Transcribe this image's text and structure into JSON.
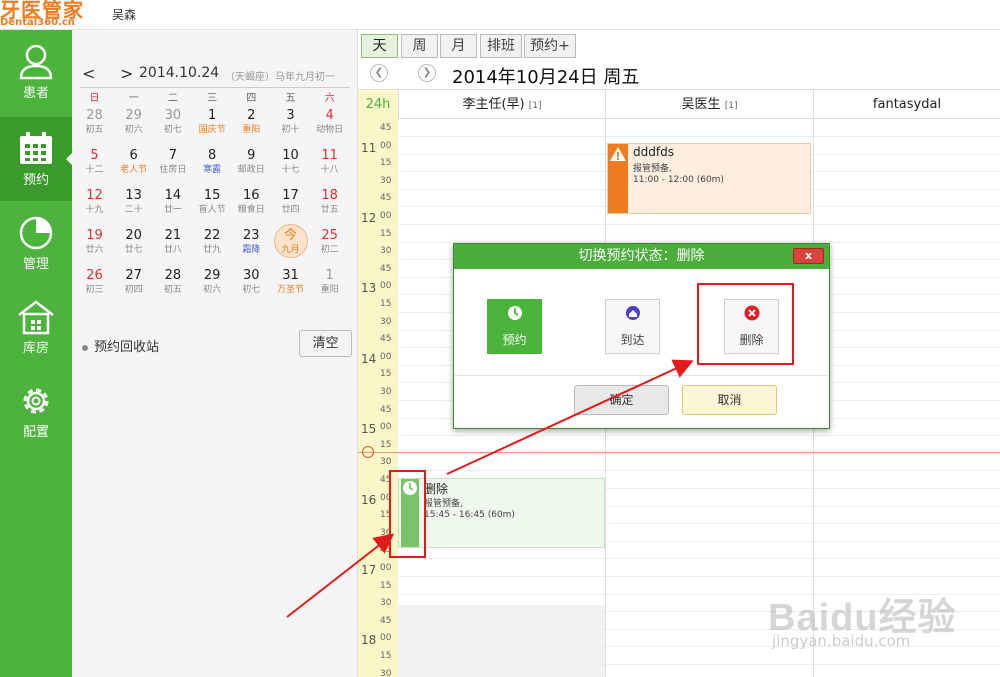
{
  "app": {
    "logo": "牙医管家",
    "logo_sub": "Dental360.cn",
    "user": "吴森"
  },
  "nav": [
    {
      "label": "患者",
      "icon": "person-icon"
    },
    {
      "label": "预约",
      "icon": "calendar-icon"
    },
    {
      "label": "管理",
      "icon": "pie-chart-icon"
    },
    {
      "label": "库房",
      "icon": "warehouse-icon"
    },
    {
      "label": "配置",
      "icon": "gear-icon"
    }
  ],
  "mini_calendar": {
    "prev": "<",
    "next": ">",
    "date": "2014.10.24",
    "lunar": "（天蝎座）马年九月初一",
    "weekdays": [
      "日",
      "一",
      "二",
      "三",
      "四",
      "五",
      "六"
    ],
    "weeks": [
      [
        {
          "n": "28",
          "l": "初五",
          "g": 1
        },
        {
          "n": "29",
          "l": "初六",
          "g": 1
        },
        {
          "n": "30",
          "l": "初七",
          "g": 1
        },
        {
          "n": "1",
          "l": "国庆节",
          "c": "orange"
        },
        {
          "n": "2",
          "l": "重阳",
          "c": "orange"
        },
        {
          "n": "3",
          "l": "初十"
        },
        {
          "n": "4",
          "l": "动物日",
          "r": 1
        }
      ],
      [
        {
          "n": "5",
          "l": "十二",
          "r": 1
        },
        {
          "n": "6",
          "l": "老人节",
          "c": "orange"
        },
        {
          "n": "7",
          "l": "住房日"
        },
        {
          "n": "8",
          "l": "寒露",
          "c": "blue"
        },
        {
          "n": "9",
          "l": "邮政日"
        },
        {
          "n": "10",
          "l": "十七"
        },
        {
          "n": "11",
          "l": "十八",
          "r": 1
        }
      ],
      [
        {
          "n": "12",
          "l": "十九",
          "r": 1
        },
        {
          "n": "13",
          "l": "二十"
        },
        {
          "n": "14",
          "l": "廿一"
        },
        {
          "n": "15",
          "l": "盲人节"
        },
        {
          "n": "16",
          "l": "粮食日"
        },
        {
          "n": "17",
          "l": "廿四"
        },
        {
          "n": "18",
          "l": "廿五",
          "r": 1
        }
      ],
      [
        {
          "n": "19",
          "l": "廿六",
          "r": 1
        },
        {
          "n": "20",
          "l": "廿七"
        },
        {
          "n": "21",
          "l": "廿八"
        },
        {
          "n": "22",
          "l": "廿九"
        },
        {
          "n": "23",
          "l": "霜降",
          "c": "blue"
        },
        {
          "n": "今",
          "l": "九月",
          "t": 1
        },
        {
          "n": "25",
          "l": "初二",
          "r": 1
        }
      ],
      [
        {
          "n": "26",
          "l": "初三",
          "r": 1
        },
        {
          "n": "27",
          "l": "初四"
        },
        {
          "n": "28",
          "l": "初五"
        },
        {
          "n": "29",
          "l": "初六"
        },
        {
          "n": "30",
          "l": "初七"
        },
        {
          "n": "31",
          "l": "万圣节",
          "c": "orange"
        },
        {
          "n": "1",
          "l": "重阳",
          "g": 1
        }
      ]
    ],
    "recycle_label": "预约回收站",
    "clear_label": "清空"
  },
  "schedule": {
    "view_tabs": [
      "天",
      "周",
      "月",
      "排班",
      "预约+"
    ],
    "active_tab": "天",
    "title": "2014年10月24日 周五",
    "all_day_label": "24h",
    "columns": [
      {
        "name": "李主任(早)",
        "count": "[1]"
      },
      {
        "name": "吴医生",
        "count": "[1]"
      },
      {
        "name": "fantasydal",
        "count": ""
      }
    ],
    "hours": [
      "11",
      "12",
      "13",
      "14",
      "15",
      "16",
      "17",
      "18"
    ],
    "hour_minute_label": "00",
    "quarter_labels": [
      "15",
      "30",
      "45"
    ],
    "appointments": [
      {
        "title": "dddfds",
        "line1": "报管预备,",
        "line2": "11:00 - 12:00 (60m)",
        "status": "warning",
        "color": "#ef7c1e"
      },
      {
        "title": "删除",
        "line1": "报管预备,",
        "line2": "15:45 - 16:45 (60m)",
        "status": "booked",
        "color": "#7cc46a"
      }
    ]
  },
  "dialog": {
    "title": "切换预约状态：删除",
    "close": "x",
    "options": [
      {
        "label": "预约",
        "icon": "clock-icon",
        "selected": true
      },
      {
        "label": "到达",
        "icon": "arrival-icon",
        "selected": false
      },
      {
        "label": "删除",
        "icon": "delete-icon",
        "selected": false
      }
    ],
    "ok": "确定",
    "cancel": "取消"
  },
  "watermark": {
    "main": "Baidu经验",
    "sub": "jingyan.baidu.com"
  },
  "colors": {
    "brand_green": "#4cb43c",
    "accent_orange": "#ef7c1e",
    "annotation_red": "#e21a1a"
  }
}
